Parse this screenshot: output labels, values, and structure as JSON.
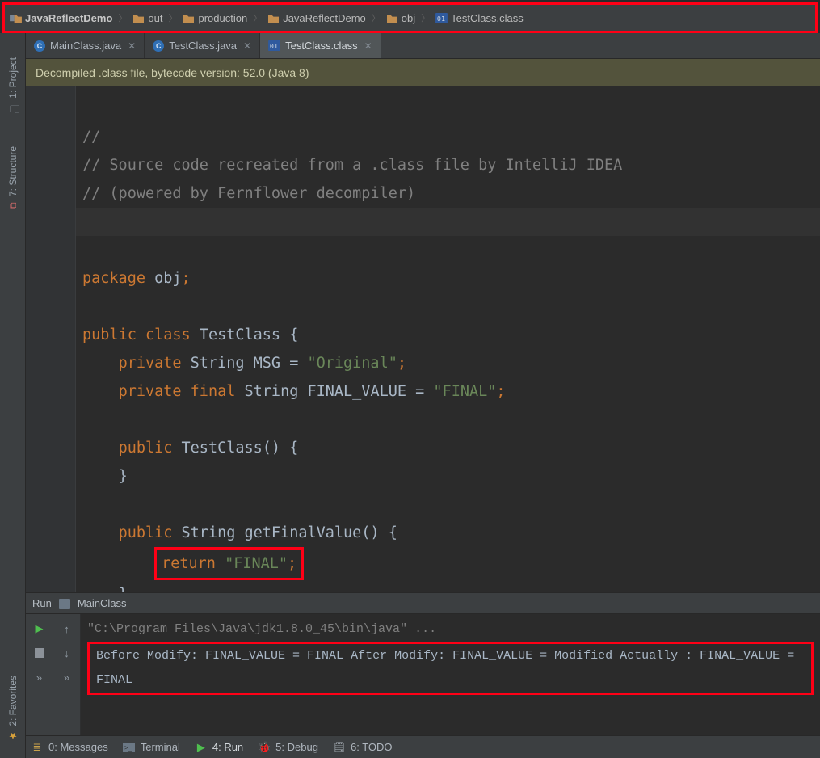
{
  "breadcrumbs": [
    {
      "label": "JavaReflectDemo",
      "icon": "prjroot",
      "bold": true
    },
    {
      "label": "out",
      "icon": "folder"
    },
    {
      "label": "production",
      "icon": "folder"
    },
    {
      "label": "JavaReflectDemo",
      "icon": "folder"
    },
    {
      "label": "obj",
      "icon": "folder"
    },
    {
      "label": "TestClass.class",
      "icon": "clsfile"
    }
  ],
  "sidebars": {
    "project": {
      "num": "1",
      "label": "Project"
    },
    "structure": {
      "num": "7",
      "label": "Structure"
    },
    "favorites": {
      "num": "2",
      "label": "Favorites"
    }
  },
  "tabs": [
    {
      "label": "MainClass.java",
      "icon": "java",
      "active": false
    },
    {
      "label": "TestClass.java",
      "icon": "java",
      "active": false
    },
    {
      "label": "TestClass.class",
      "icon": "cls",
      "active": true
    }
  ],
  "notice": "Decompiled .class file, bytecode version: 52.0 (Java 8)",
  "code": {
    "c1": "//",
    "c2": "// Source code recreated from a .class file by IntelliJ IDEA",
    "c3": "// (powered by Fernflower decompiler)",
    "c4": "//",
    "pkg_kw": "package",
    "pkg_name": " obj",
    "pub": "public",
    "cls": "class",
    "name": " TestClass {",
    "priv": "private",
    "str_t": " String ",
    "msg": "MSG = ",
    "msg_v": "\"Original\"",
    "final": "final",
    "fv": "FINAL_VALUE = ",
    "fv_v": "\"FINAL\"",
    "ctor": "TestClass() {",
    "close": "}",
    "mret": " String ",
    "mname": "getFinalValue() {",
    "ret": "return",
    "ret_v": " \"FINAL\""
  },
  "run": {
    "title": "Run",
    "app": "MainClass",
    "cmd": "\"C:\\Program Files\\Java\\jdk1.8.0_45\\bin\\java\" ...",
    "l1": "Before Modify: FINAL_VALUE = FINAL",
    "l2": "After Modify: FINAL_VALUE = Modified",
    "l3": "Actually : FINAL_VALUE = FINAL"
  },
  "bbar": {
    "messages": {
      "num": "0",
      "label": "Messages"
    },
    "terminal": "Terminal",
    "run": {
      "num": "4",
      "label": "Run"
    },
    "debug": {
      "num": "5",
      "label": "Debug"
    },
    "todo": {
      "num": "6",
      "label": "TODO"
    }
  }
}
